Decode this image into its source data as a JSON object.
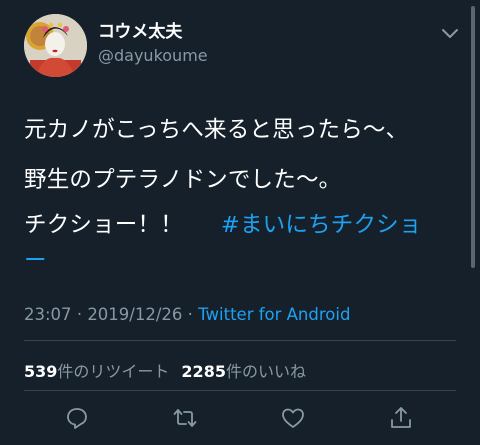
{
  "author": {
    "display_name": "コウメ太夫",
    "handle": "@dayukoume"
  },
  "tweet": {
    "line1": "元カノがこっちへ来ると思ったら～、",
    "line2": "野生のプテラノドンでした～。",
    "line3_text": "チクショー！！",
    "hashtag_part1": "#まいにちチクショ",
    "hashtag_part2": "ー"
  },
  "meta": {
    "time": "23:07",
    "separator1": "·",
    "date": "2019/12/26",
    "separator2": "·",
    "source": "Twitter for Android"
  },
  "stats": {
    "retweets_count": "539",
    "retweets_label": "件のリツイート",
    "likes_count": "2285",
    "likes_label": "件のいいね"
  },
  "colors": {
    "background": "#15202b",
    "link": "#1da1f2",
    "secondary_text": "#8899a6",
    "divider": "#38444d"
  },
  "icons": {
    "menu": "chevron-down-icon",
    "reply": "reply-icon",
    "retweet": "retweet-icon",
    "like": "heart-icon",
    "share": "share-icon"
  }
}
